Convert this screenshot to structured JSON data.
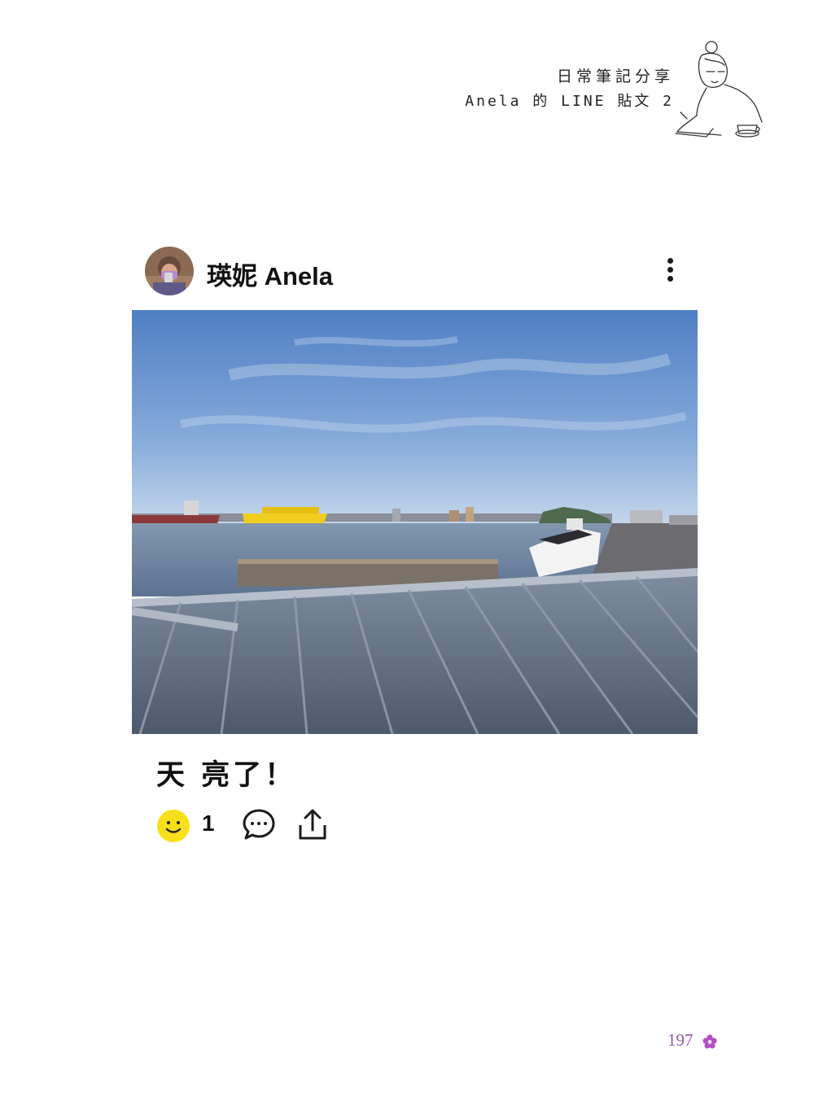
{
  "header": {
    "line1": "日常筆記分享",
    "line2": "Anela 的 LINE 貼文 2",
    "sketch_icon": "woman-writing-illustration"
  },
  "post": {
    "author": "瑛妮 Anela",
    "avatar_icon": "user-avatar-photo",
    "more_icon": "more-vertical-icon",
    "photo_description_icon": "harbor-photo",
    "caption": "天 亮了！",
    "reaction_icon": "smiley-reaction-icon",
    "reaction_count": "1",
    "comment_icon": "comment-bubble-icon",
    "share_icon": "share-icon"
  },
  "footer": {
    "page_number": "197",
    "flower_icon": "flower-icon",
    "accent_color": "#8a5aa8"
  },
  "colors": {
    "reaction_yellow": "#f7e01a",
    "sky_blue": "#6f97d0"
  }
}
